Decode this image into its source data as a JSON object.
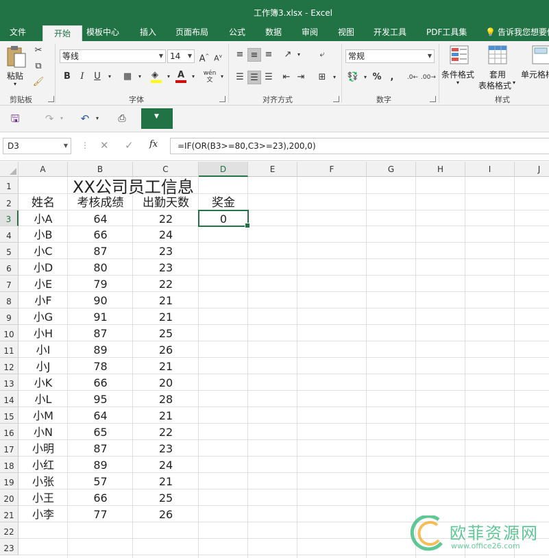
{
  "window": {
    "title": "工作簿3.xlsx - Excel",
    "accent_color": "#217346"
  },
  "ribbon_tabs": [
    {
      "label": "文件",
      "active": false
    },
    {
      "label": "开始",
      "active": true
    },
    {
      "label": "模板中心",
      "active": false
    },
    {
      "label": "插入",
      "active": false
    },
    {
      "label": "页面布局",
      "active": false
    },
    {
      "label": "公式",
      "active": false
    },
    {
      "label": "数据",
      "active": false
    },
    {
      "label": "审阅",
      "active": false
    },
    {
      "label": "视图",
      "active": false
    },
    {
      "label": "开发工具",
      "active": false
    },
    {
      "label": "PDF工具集",
      "active": false
    }
  ],
  "tell_me": "告诉我您想要做",
  "ribbon": {
    "clipboard": {
      "label": "剪贴板",
      "paste": "粘贴"
    },
    "font": {
      "label": "字体",
      "font_name": "等线",
      "font_size": "14",
      "wen": "wén"
    },
    "alignment": {
      "label": "对齐方式"
    },
    "number": {
      "label": "数字",
      "format": "常规"
    },
    "styles": {
      "label": "样式",
      "conditional": "条件格式",
      "table_format_1": "套用",
      "table_format_2": "表格格式",
      "cell_styles": "单元格样式"
    }
  },
  "formula_bar": {
    "name_box": "D3",
    "fx": "fx",
    "formula": "=IF(OR(B3>=80,C3>=23),200,0)"
  },
  "grid": {
    "columns": [
      "A",
      "B",
      "C",
      "D",
      "E",
      "F",
      "G",
      "H",
      "I",
      "J"
    ],
    "selected_column": "D",
    "selected_row": 3,
    "rows": [
      "1",
      "2",
      "3",
      "4",
      "5",
      "6",
      "7",
      "8",
      "9",
      "10",
      "11",
      "12",
      "13",
      "14",
      "15",
      "16",
      "17",
      "18",
      "19",
      "20",
      "21",
      "22",
      "23"
    ],
    "title": "XX公司员工信息",
    "headers": [
      "姓名",
      "考核成绩",
      "出勤天数",
      "奖金"
    ],
    "data": [
      [
        "小A",
        "64",
        "22",
        "0"
      ],
      [
        "小B",
        "66",
        "24",
        ""
      ],
      [
        "小C",
        "87",
        "23",
        ""
      ],
      [
        "小D",
        "80",
        "23",
        ""
      ],
      [
        "小E",
        "79",
        "22",
        ""
      ],
      [
        "小F",
        "90",
        "21",
        ""
      ],
      [
        "小G",
        "91",
        "21",
        ""
      ],
      [
        "小H",
        "87",
        "25",
        ""
      ],
      [
        "小I",
        "89",
        "26",
        ""
      ],
      [
        "小J",
        "78",
        "21",
        ""
      ],
      [
        "小K",
        "66",
        "20",
        ""
      ],
      [
        "小L",
        "95",
        "28",
        ""
      ],
      [
        "小M",
        "64",
        "21",
        ""
      ],
      [
        "小N",
        "65",
        "22",
        ""
      ],
      [
        "小明",
        "87",
        "23",
        ""
      ],
      [
        "小红",
        "89",
        "24",
        ""
      ],
      [
        "小张",
        "57",
        "21",
        ""
      ],
      [
        "小王",
        "66",
        "25",
        ""
      ],
      [
        "小李",
        "77",
        "26",
        ""
      ]
    ]
  },
  "watermark": {
    "text": "欧菲资源网",
    "url": "www.office26.com"
  }
}
